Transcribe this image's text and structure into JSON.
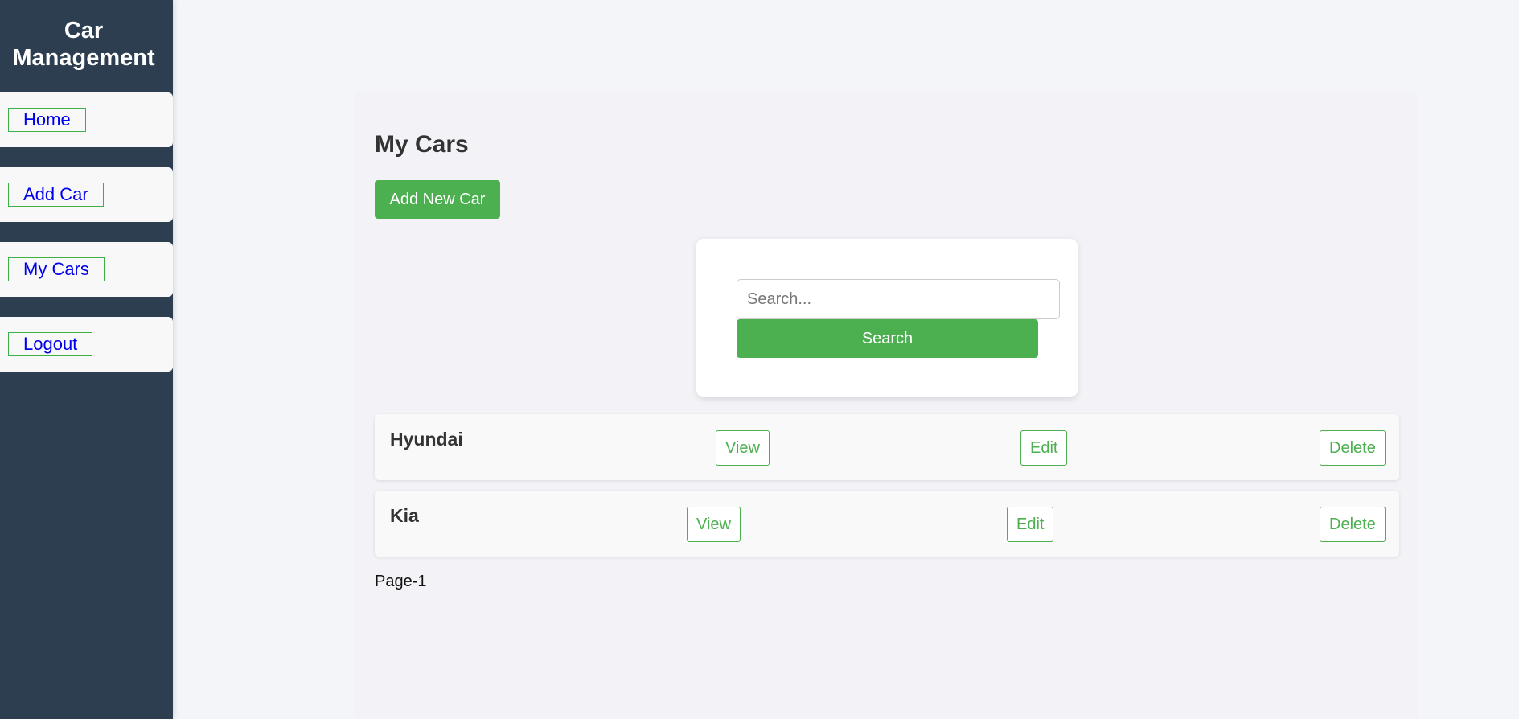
{
  "sidebar": {
    "title": "Car Management",
    "items": [
      {
        "label": "Home"
      },
      {
        "label": "Add Car"
      },
      {
        "label": "My Cars"
      },
      {
        "label": "Logout"
      }
    ]
  },
  "main": {
    "title": "My Cars",
    "add_button": "Add New Car",
    "search": {
      "placeholder": "Search...",
      "value": "",
      "button": "Search"
    },
    "cars": [
      {
        "name": "Hyundai",
        "view": "View",
        "edit": "Edit",
        "delete": "Delete"
      },
      {
        "name": "Kia",
        "view": "View",
        "edit": "Edit",
        "delete": "Delete"
      }
    ],
    "page_label": "Page-1"
  },
  "colors": {
    "sidebar_bg": "#2c3e50",
    "accent_green": "#4caf50",
    "link_blue": "#0000ee",
    "page_bg": "#f4f5f9"
  }
}
